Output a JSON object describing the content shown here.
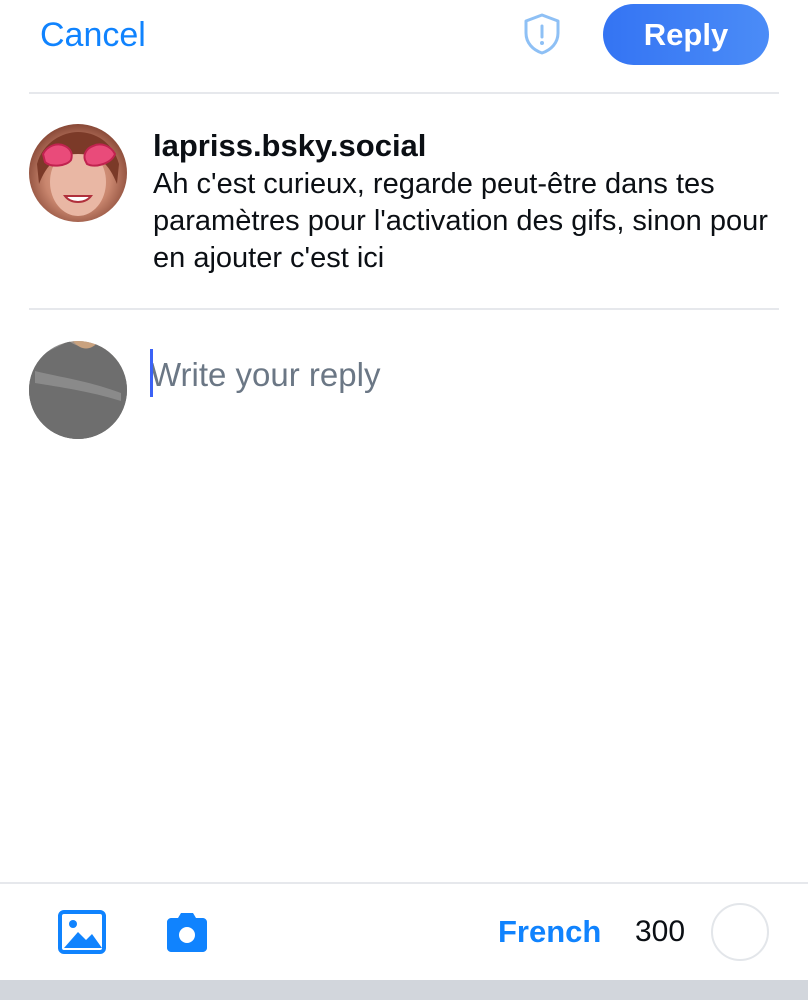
{
  "header": {
    "cancel_label": "Cancel",
    "reply_label": "Reply",
    "shield_icon": "shield-exclamation-icon"
  },
  "parent_post": {
    "handle": "lapriss.bsky.social",
    "text": "Ah c'est curieux, regarde peut-être dans tes paramètres pour l'activation des gifs, sinon pour en ajouter c'est ici"
  },
  "composer": {
    "placeholder": "Write your reply",
    "value": ""
  },
  "toolbar": {
    "image_icon": "image-icon",
    "camera_icon": "camera-icon",
    "language_label": "French",
    "char_count": "300"
  },
  "colors": {
    "accent": "#1083fe",
    "reply_button": "#3d7ef5",
    "divider": "#e6e8ec",
    "text": "#0b0f14",
    "placeholder": "#6b7785"
  }
}
